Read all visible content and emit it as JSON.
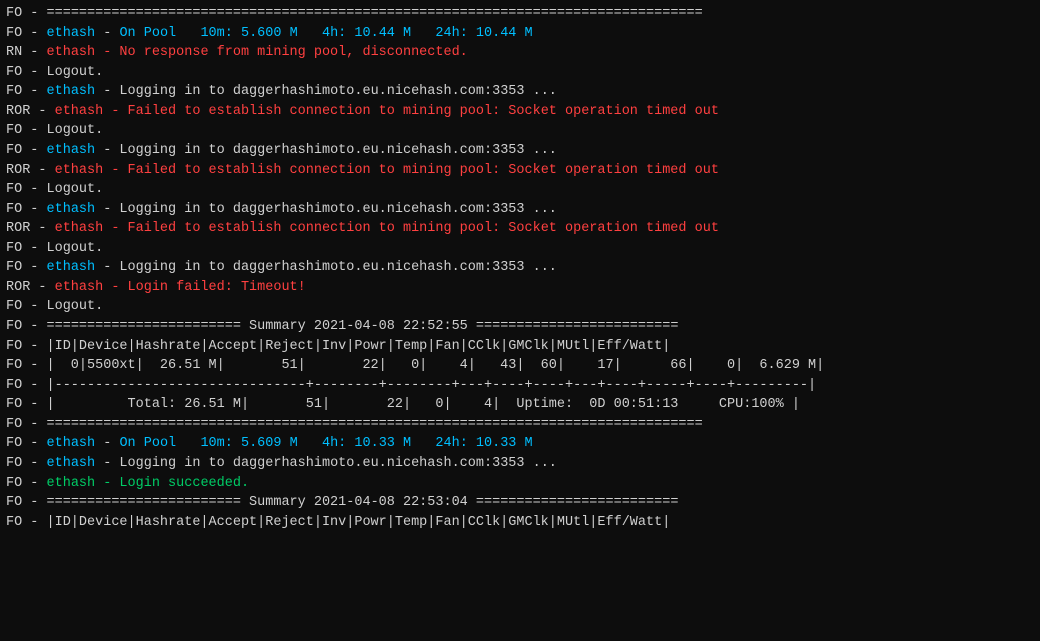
{
  "terminal": {
    "lines": [
      {
        "id": 1,
        "parts": [
          {
            "text": "FO - ",
            "cls": "white"
          },
          {
            "text": "=================================================================================",
            "cls": "white"
          }
        ]
      },
      {
        "id": 2,
        "parts": [
          {
            "text": "FO - ",
            "cls": "white"
          },
          {
            "text": "ethash",
            "cls": "cyan"
          },
          {
            "text": " - ",
            "cls": "white"
          },
          {
            "text": "On Pool",
            "cls": "cyan"
          },
          {
            "text": "   10m: 5.600 M   4h: 10.44 M   24h: 10.44 M",
            "cls": "cyan"
          }
        ]
      },
      {
        "id": 3,
        "parts": [
          {
            "text": "RN - ",
            "cls": "white"
          },
          {
            "text": "ethash - No response from mining pool, disconnected.",
            "cls": "red"
          }
        ]
      },
      {
        "id": 4,
        "parts": [
          {
            "text": "FO - Logout.",
            "cls": "white"
          }
        ]
      },
      {
        "id": 5,
        "parts": [
          {
            "text": "FO - ",
            "cls": "white"
          },
          {
            "text": "ethash",
            "cls": "cyan"
          },
          {
            "text": " - Logging in to daggerhashimoto.eu.nicehash.com:3353 ...",
            "cls": "white"
          }
        ]
      },
      {
        "id": 6,
        "parts": [
          {
            "text": "ROR - ",
            "cls": "white"
          },
          {
            "text": "ethash - Failed to establish connection to mining pool: Socket operation timed out",
            "cls": "red"
          }
        ]
      },
      {
        "id": 7,
        "parts": [
          {
            "text": "FO - Logout.",
            "cls": "white"
          }
        ]
      },
      {
        "id": 8,
        "parts": [
          {
            "text": "FO - ",
            "cls": "white"
          },
          {
            "text": "ethash",
            "cls": "cyan"
          },
          {
            "text": " - Logging in to daggerhashimoto.eu.nicehash.com:3353 ...",
            "cls": "white"
          }
        ]
      },
      {
        "id": 9,
        "parts": [
          {
            "text": "ROR - ",
            "cls": "white"
          },
          {
            "text": "ethash - Failed to establish connection to mining pool: Socket operation timed out",
            "cls": "red"
          }
        ]
      },
      {
        "id": 10,
        "parts": [
          {
            "text": "FO - Logout.",
            "cls": "white"
          }
        ]
      },
      {
        "id": 11,
        "parts": [
          {
            "text": "FO - ",
            "cls": "white"
          },
          {
            "text": "ethash",
            "cls": "cyan"
          },
          {
            "text": " - Logging in to daggerhashimoto.eu.nicehash.com:3353 ...",
            "cls": "white"
          }
        ]
      },
      {
        "id": 12,
        "parts": [
          {
            "text": "ROR - ",
            "cls": "white"
          },
          {
            "text": "ethash - Failed to establish connection to mining pool: Socket operation timed out",
            "cls": "red"
          }
        ]
      },
      {
        "id": 13,
        "parts": [
          {
            "text": "FO - Logout.",
            "cls": "white"
          }
        ]
      },
      {
        "id": 14,
        "parts": [
          {
            "text": "FO - ",
            "cls": "white"
          },
          {
            "text": "ethash",
            "cls": "cyan"
          },
          {
            "text": " - Logging in to daggerhashimoto.eu.nicehash.com:3353 ...",
            "cls": "white"
          }
        ]
      },
      {
        "id": 15,
        "parts": [
          {
            "text": "ROR - ",
            "cls": "white"
          },
          {
            "text": "ethash - Login failed: Timeout!",
            "cls": "red"
          }
        ]
      },
      {
        "id": 16,
        "parts": [
          {
            "text": "FO - Logout.",
            "cls": "white"
          }
        ]
      },
      {
        "id": 17,
        "parts": [
          {
            "text": "FO - ",
            "cls": "white"
          },
          {
            "text": "======================== Summary 2021-04-08 22:52:55 =========================",
            "cls": "white"
          }
        ]
      },
      {
        "id": 18,
        "parts": [
          {
            "text": "FO - |ID|Device|Hashrate|Accept|Reject|Inv|Powr|Temp|Fan|CClk|GMClk|MUtl|Eff/Watt|",
            "cls": "white"
          }
        ]
      },
      {
        "id": 19,
        "parts": [
          {
            "text": "FO - |  0|5500xt|  26.51 M|       51|       22|   0|    4|   43|  60|    17|      66|    0|  6.629 M|",
            "cls": "white"
          }
        ]
      },
      {
        "id": 20,
        "parts": [
          {
            "text": "FO - |-------------------------------+--------+--------+---+----+----+---+----+-----+----+---------|",
            "cls": "white"
          }
        ]
      },
      {
        "id": 21,
        "parts": [
          {
            "text": "FO - |         Total: 26.51 M|       51|       22|   0|    4|  Uptime:  0D 00:51:13     CPU:100% |",
            "cls": "white"
          }
        ]
      },
      {
        "id": 22,
        "parts": [
          {
            "text": "FO - ",
            "cls": "white"
          },
          {
            "text": "=================================================================================",
            "cls": "white"
          }
        ]
      },
      {
        "id": 23,
        "parts": [
          {
            "text": "FO - ",
            "cls": "white"
          },
          {
            "text": "ethash",
            "cls": "cyan"
          },
          {
            "text": " - ",
            "cls": "white"
          },
          {
            "text": "On Pool",
            "cls": "cyan"
          },
          {
            "text": "   10m: 5.609 M   4h: 10.33 M   24h: 10.33 M",
            "cls": "cyan"
          }
        ]
      },
      {
        "id": 24,
        "parts": [
          {
            "text": "FO - ",
            "cls": "white"
          },
          {
            "text": "ethash",
            "cls": "cyan"
          },
          {
            "text": " - Logging in to daggerhashimoto.eu.nicehash.com:3353 ...",
            "cls": "white"
          }
        ]
      },
      {
        "id": 25,
        "parts": [
          {
            "text": "FO - ",
            "cls": "white"
          },
          {
            "text": "ethash - Login succeeded.",
            "cls": "green"
          }
        ]
      },
      {
        "id": 26,
        "parts": [
          {
            "text": "FO - ",
            "cls": "white"
          },
          {
            "text": "======================== Summary 2021-04-08 22:53:04 =========================",
            "cls": "white"
          }
        ]
      },
      {
        "id": 27,
        "parts": [
          {
            "text": "FO - |ID|Device|Hashrate|Accept|Reject|Inv|Powr|Temp|Fan|CClk|GMClk|MUtl|Eff/Watt|",
            "cls": "white"
          }
        ]
      }
    ]
  }
}
